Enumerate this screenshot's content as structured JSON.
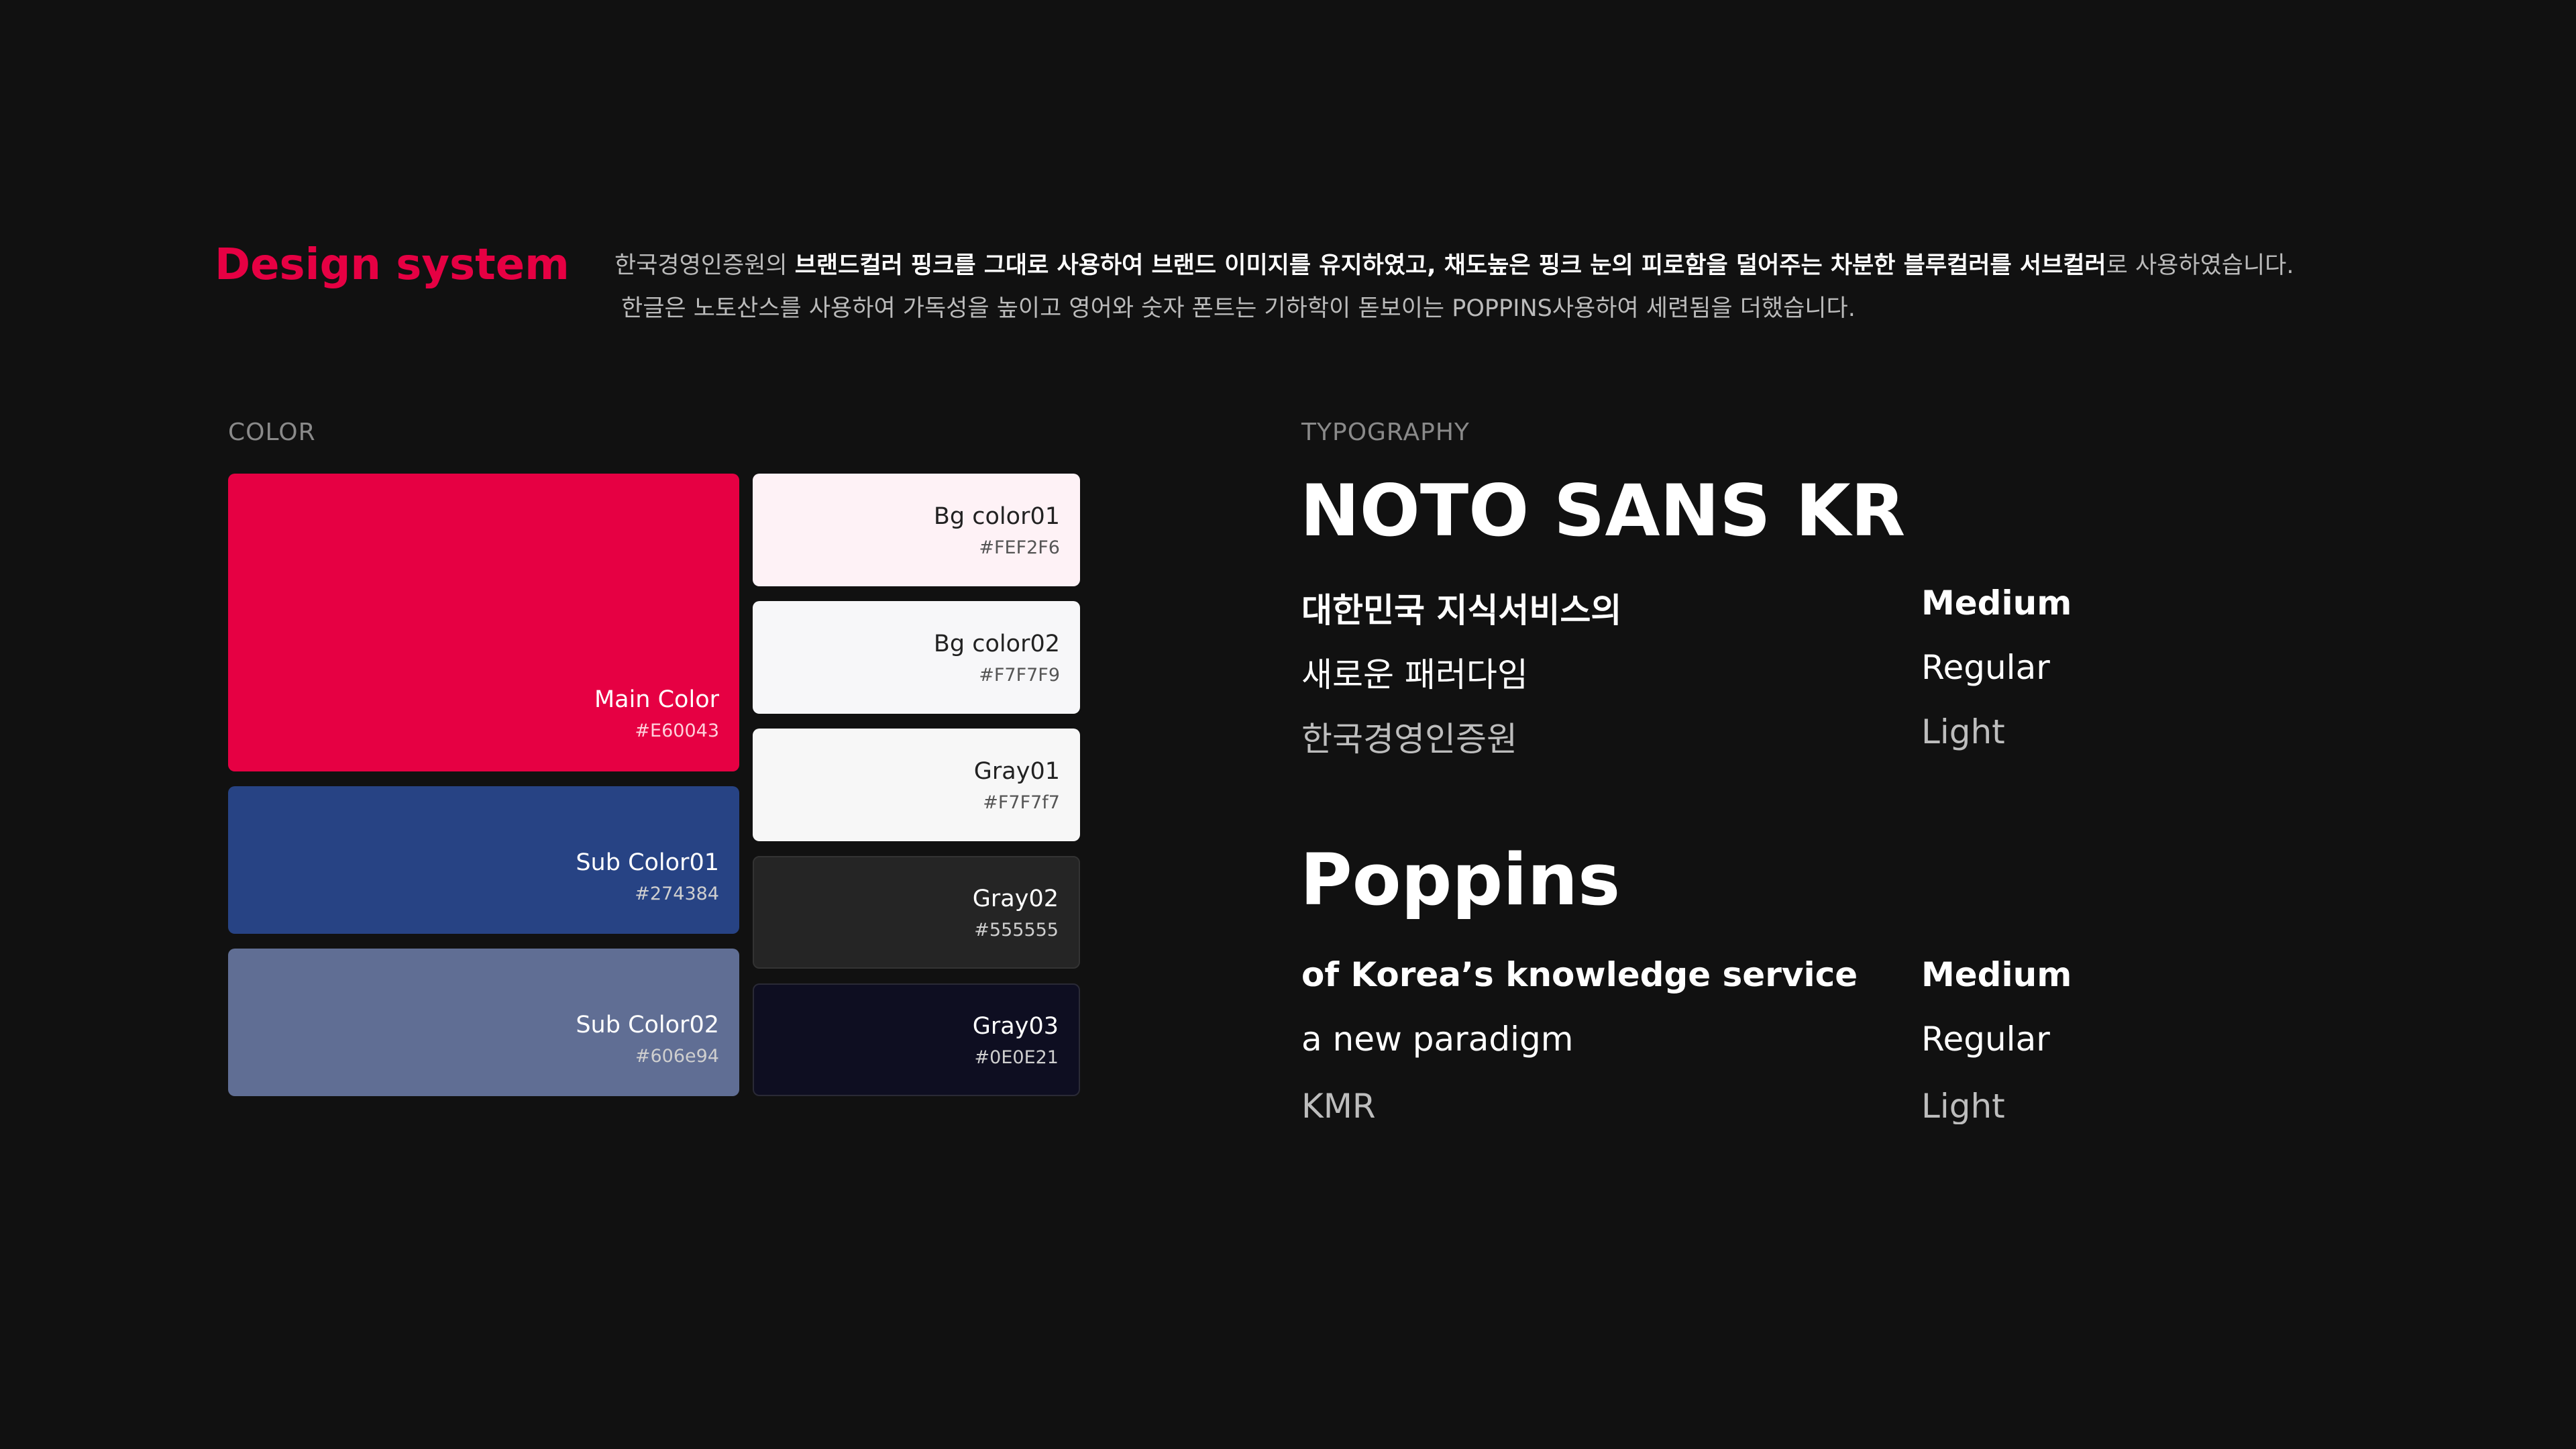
{
  "header": {
    "title": "Design system",
    "intro_line1_prefix": "한국경영인증원의 ",
    "intro_line1_bold": "브랜드컬러 핑크를 그대로 사용하여 브랜드 이미지를 유지하였고, 채도높은 핑크 눈의 피로함을 덜어주는 차분한 블루컬러를 서브컬러",
    "intro_line1_suffix": "로 사용하였습니다.",
    "intro_line2": "한글은 노토산스를 사용하여 가독성을 높이고 영어와 숫자 폰트는 기하학이 돋보이는 POPPINS사용하여 세련됨을 더했습니다."
  },
  "color": {
    "label": "COLOR",
    "main": {
      "name": "Main Color",
      "hex": "#E60043"
    },
    "sub1": {
      "name": "Sub Color01",
      "hex": "#274384"
    },
    "sub2": {
      "name": "Sub Color02",
      "hex": "#606e94"
    },
    "bg1": {
      "name": "Bg color01",
      "hex": "#FEF2F6"
    },
    "bg2": {
      "name": "Bg color02",
      "hex": "#F7F7F9"
    },
    "gray1": {
      "name": "Gray01",
      "hex": "#F7F7f7"
    },
    "gray2": {
      "name": "Gray02",
      "hex": "#555555"
    },
    "gray3": {
      "name": "Gray03",
      "hex": "#0E0E21"
    }
  },
  "typography": {
    "label": "TYPOGRAPHY",
    "noto": {
      "name": "NOTO SANS KR",
      "samples": [
        "대한민국 지식서비스의",
        "새로운 패러다임",
        "한국경영인증원"
      ],
      "weights": [
        "Medium",
        "Regular",
        "Light"
      ]
    },
    "poppins": {
      "name": "Poppins",
      "samples": [
        "of Korea’s knowledge service",
        "a new paradigm",
        "KMR"
      ],
      "weights": [
        "Medium",
        "Regular",
        "Light"
      ]
    }
  }
}
